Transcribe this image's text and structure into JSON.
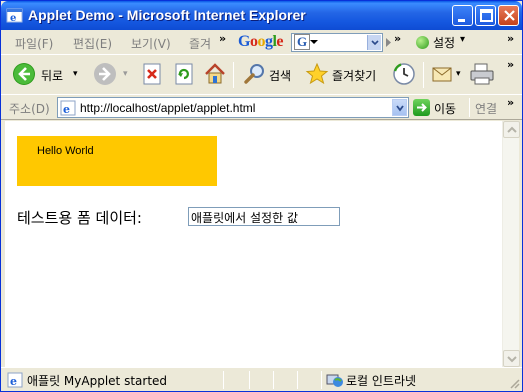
{
  "window": {
    "title": "Applet Demo - Microsoft Internet Explorer",
    "controls": [
      "minimize",
      "maximize",
      "close"
    ]
  },
  "menu": {
    "items": [
      "파일(F)",
      "편집(E)",
      "보기(V)",
      "즐겨"
    ],
    "overflow": "»",
    "google_logo": "Google",
    "google_box_letter": "G",
    "google_overflow": "»",
    "settings_label": "설정",
    "settings_arrow": "▾",
    "right_overflow": "»"
  },
  "toolbar": {
    "back_label": "뒤로",
    "back_arrow": "▾",
    "search_label": "검색",
    "favorites_label": "즐겨찾기",
    "overflow": "»"
  },
  "address": {
    "label": "주소(D)",
    "url": "http://localhost/applet/applet.html",
    "go_label": "이동",
    "links_label": "연결",
    "links_overflow": "»"
  },
  "page": {
    "applet_text": "Hello World",
    "applet_color": "#FFC800",
    "form_label": "테스트용 폼 데이터:",
    "form_value": "애플릿에서 설정한 값"
  },
  "status": {
    "text": "애플릿 MyApplet started",
    "zone": "로컬 인트라넷"
  },
  "colors": {
    "titlebar": "#2466E6",
    "chrome": "#ECE9D8",
    "accent_green": "#2E9B1C"
  }
}
